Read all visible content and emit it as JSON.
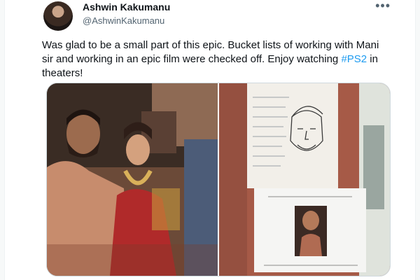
{
  "tweet": {
    "author": {
      "name": "Ashwin Kakumanu",
      "handle": "@AshwinKakumanu"
    },
    "more_icon": "more-horizontal-icon",
    "text_before": "Was glad to be a small part of this epic. Bucket lists of working with Mani sir and working in an epic film were checked off. Enjoy watching ",
    "hashtag": "#PS2",
    "text_after": " in theaters!",
    "media": [
      {
        "kind": "photo",
        "subject": "film-set-costume-photo"
      },
      {
        "kind": "photo",
        "subject": "character-sketch-and-portrait-on-board"
      }
    ]
  },
  "colors": {
    "link": "#1d9bf0",
    "text": "#0f1419",
    "secondary": "#536471",
    "border": "#cfd9de"
  }
}
